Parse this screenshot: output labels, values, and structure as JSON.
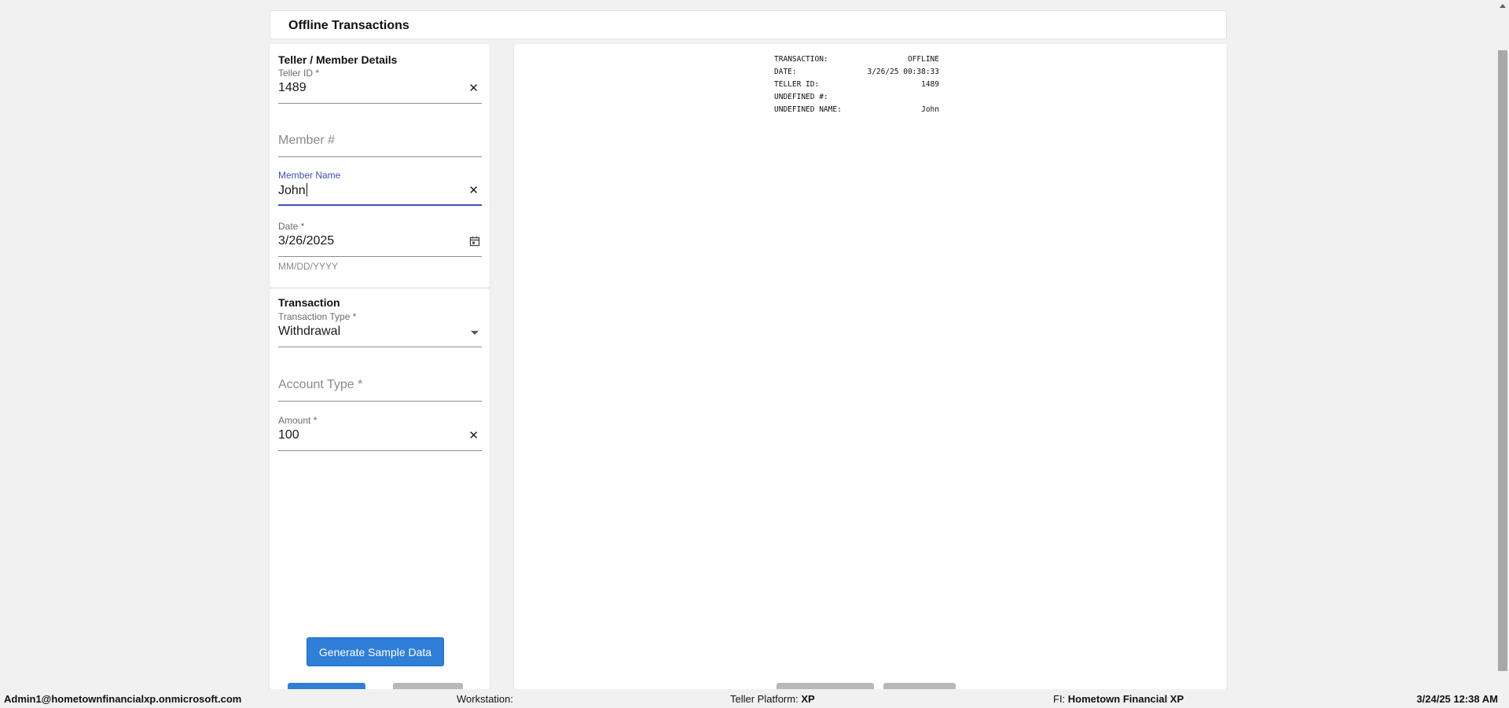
{
  "header": {
    "title": "Offline Transactions"
  },
  "teller_member": {
    "section_title": "Teller / Member Details",
    "teller_id": {
      "label": "Teller ID *",
      "value": "1489"
    },
    "member_number": {
      "placeholder": "Member #"
    },
    "member_name": {
      "label": "Member Name",
      "value": "John"
    },
    "date": {
      "label": "Date *",
      "value": "3/26/2025",
      "helper": "MM/DD/YYYY"
    }
  },
  "transaction": {
    "section_title": "Transaction",
    "transaction_type": {
      "label": "Transaction Type *",
      "value": "Withdrawal"
    },
    "account_type": {
      "placeholder": "Account Type *"
    },
    "amount": {
      "label": "Amount *",
      "value": "100"
    }
  },
  "buttons": {
    "generate_sample_data": "Generate Sample Data"
  },
  "receipt": {
    "rows": [
      {
        "key": "TRANSACTION:",
        "value": "OFFLINE"
      },
      {
        "key": "DATE:",
        "value": "3/26/25 00:38:33"
      },
      {
        "key": "TELLER ID:",
        "value": "1489"
      },
      {
        "key": "UNDEFINED #:",
        "value": ""
      },
      {
        "key": "UNDEFINED NAME:",
        "value": "John"
      }
    ]
  },
  "status_bar": {
    "user": "Admin1@hometownfinancialxp.onmicrosoft.com",
    "workstation_label": "Workstation:",
    "workstation_value": "",
    "platform_label": "Teller Platform:",
    "platform_value": "XP",
    "fi_label": "FI:",
    "fi_value": "Hometown Financial XP",
    "datetime": "3/24/25 12:38 AM"
  },
  "colors": {
    "primary": "#2f7fd8",
    "focus": "#3f51b5",
    "background": "#f1f1f1"
  },
  "icons": {
    "clear": "close-icon",
    "calendar": "calendar-icon",
    "dropdown": "chevron-down-icon"
  }
}
